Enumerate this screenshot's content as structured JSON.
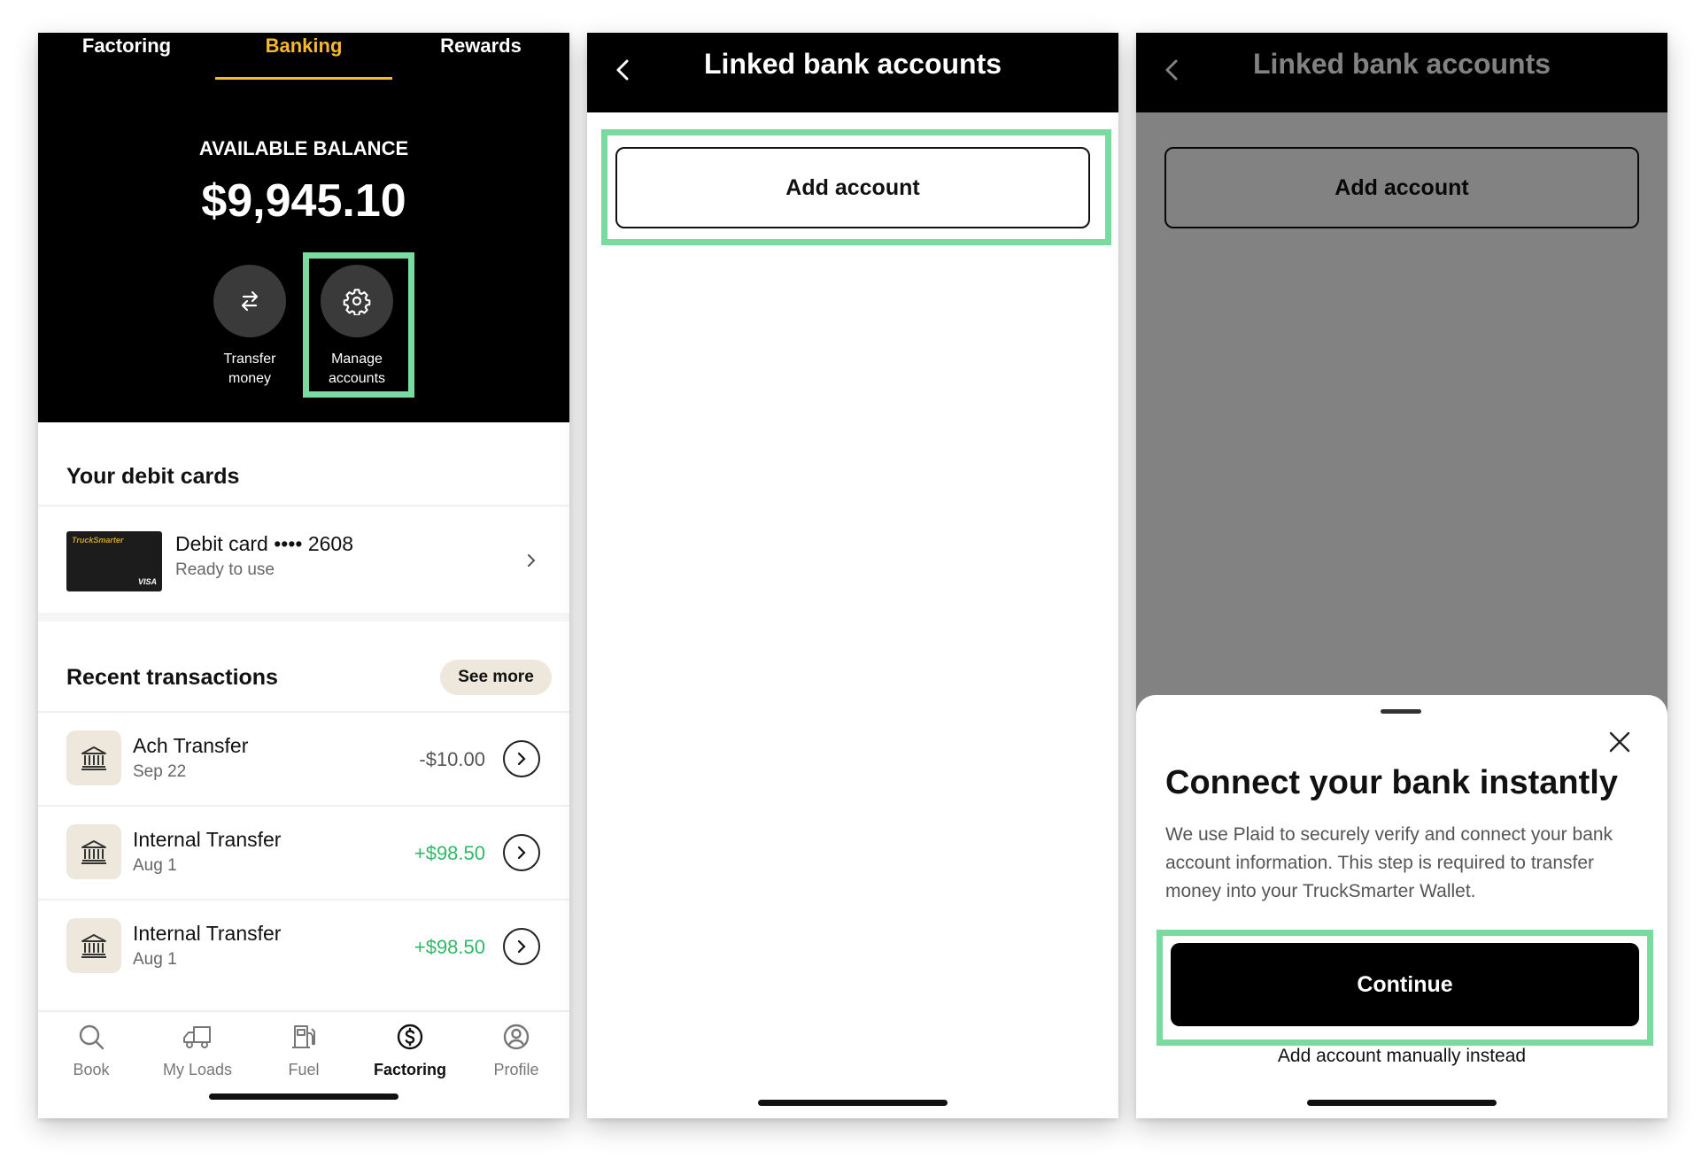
{
  "screen1": {
    "tabs": [
      {
        "label": "Factoring"
      },
      {
        "label": "Banking",
        "active": true
      },
      {
        "label": "Rewards"
      }
    ],
    "balance_label": "AVAILABLE BALANCE",
    "balance_value": "$9,945.10",
    "actions": {
      "transfer_line1": "Transfer",
      "transfer_line2": "money",
      "manage_line1": "Manage",
      "manage_line2": "accounts"
    },
    "debit_title": "Your debit cards",
    "debit_card": {
      "brand": "TruckSmarter",
      "network": "VISA",
      "title": "Debit card •••• 2608",
      "status": "Ready to use"
    },
    "recent_title": "Recent transactions",
    "see_more": "See more",
    "transactions": [
      {
        "title": "Ach Transfer",
        "date": "Sep 22",
        "amount": "-$10.00"
      },
      {
        "title": "Internal Transfer",
        "date": "Aug 1",
        "amount": "+$98.50"
      },
      {
        "title": "Internal Transfer",
        "date": "Aug 1",
        "amount": "+$98.50"
      }
    ],
    "nav": [
      {
        "label": "Book",
        "icon": "search-icon"
      },
      {
        "label": "My Loads",
        "icon": "truck-icon"
      },
      {
        "label": "Fuel",
        "icon": "fuel-pump-icon"
      },
      {
        "label": "Factoring",
        "icon": "dollar-circle-icon",
        "active": true
      },
      {
        "label": "Profile",
        "icon": "user-circle-icon"
      }
    ]
  },
  "screen2": {
    "title": "Linked bank accounts",
    "add_account": "Add account"
  },
  "screen3": {
    "title": "Linked bank accounts",
    "add_account": "Add account",
    "sheet_title": "Connect your bank instantly",
    "sheet_body": "We use Plaid to securely verify and connect your bank account information. This step is required to transfer money into your TruckSmarter Wallet.",
    "continue": "Continue",
    "manual": "Add account manually instead"
  },
  "colors": {
    "accent": "#f5b82e",
    "highlight": "#7adba0",
    "positive": "#2fb866",
    "chip": "#ede7dc"
  }
}
